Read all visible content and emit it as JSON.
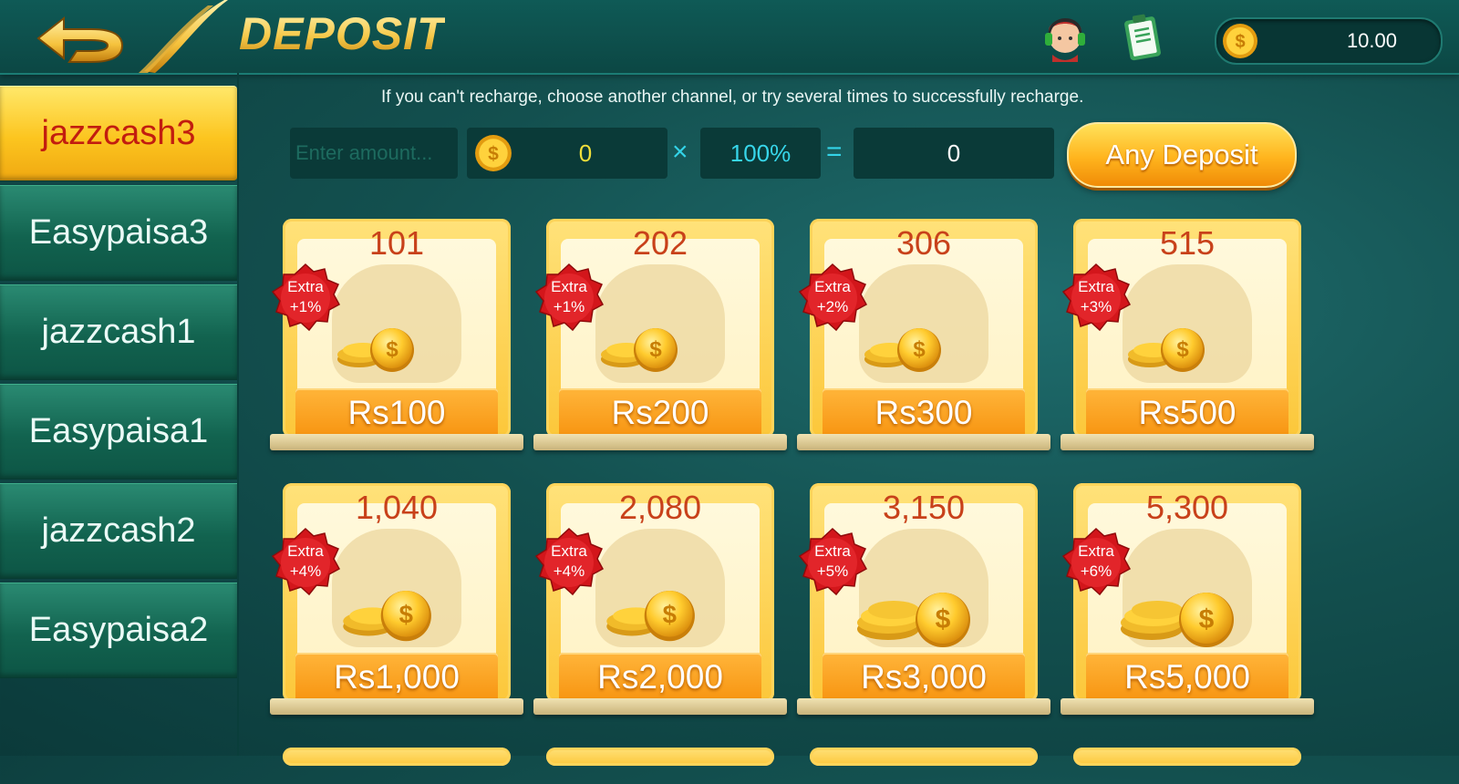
{
  "header": {
    "title": "DEPOSIT",
    "balance": "10.00"
  },
  "sidebar": {
    "items": [
      {
        "label": "jazzcash3",
        "active": true
      },
      {
        "label": "Easypaisa3",
        "active": false
      },
      {
        "label": "jazzcash1",
        "active": false
      },
      {
        "label": "Easypaisa1",
        "active": false
      },
      {
        "label": "jazzcash2",
        "active": false
      },
      {
        "label": "Easypaisa2",
        "active": false
      }
    ]
  },
  "notice": "If you can't recharge, choose another channel, or try several times to successfully recharge.",
  "amount_row": {
    "input_placeholder": "Enter amount...",
    "coin_value": "0",
    "multiply": "×",
    "rate": "100%",
    "equals": "=",
    "result": "0",
    "any_deposit_label": "Any Deposit"
  },
  "packages": [
    {
      "chips": "101",
      "extra_label": "Extra",
      "extra": "+1%",
      "price": "Rs100"
    },
    {
      "chips": "202",
      "extra_label": "Extra",
      "extra": "+1%",
      "price": "Rs200"
    },
    {
      "chips": "306",
      "extra_label": "Extra",
      "extra": "+2%",
      "price": "Rs300"
    },
    {
      "chips": "515",
      "extra_label": "Extra",
      "extra": "+3%",
      "price": "Rs500"
    },
    {
      "chips": "1,040",
      "extra_label": "Extra",
      "extra": "+4%",
      "price": "Rs1,000"
    },
    {
      "chips": "2,080",
      "extra_label": "Extra",
      "extra": "+4%",
      "price": "Rs2,000"
    },
    {
      "chips": "3,150",
      "extra_label": "Extra",
      "extra": "+5%",
      "price": "Rs3,000"
    },
    {
      "chips": "5,300",
      "extra_label": "Extra",
      "extra": "+6%",
      "price": "Rs5,000"
    }
  ],
  "colors": {
    "accent_gold": "#fcc51f",
    "active_text": "#c21d0f",
    "badge_red": "#d61a1a",
    "rate_cyan": "#37d6ea"
  },
  "icons": {
    "back": "back-arrow-icon",
    "support": "customer-support-icon",
    "record": "clipboard-record-icon",
    "coin": "gold-coin-icon"
  }
}
